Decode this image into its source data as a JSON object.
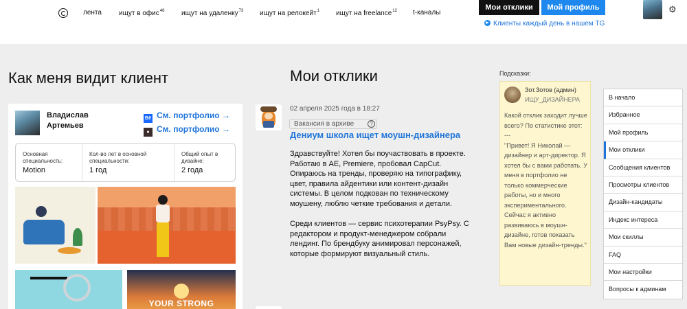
{
  "header": {
    "nav": [
      {
        "label": "лента",
        "count": ""
      },
      {
        "label": "ищут в офис",
        "count": "46"
      },
      {
        "label": "ищут на удаленку",
        "count": "73"
      },
      {
        "label": "ищут на релокейт",
        "count": "1"
      },
      {
        "label": "ищут на freelance",
        "count": "12"
      },
      {
        "label": "t-каналы",
        "count": ""
      }
    ],
    "my_responses_button": "Мои отклики",
    "my_profile_button": "Мой профиль",
    "tg_link": "Клиенты каждый день в нашем TG"
  },
  "left": {
    "title": "Как меня видит клиент",
    "name": "Владислав Артемьев",
    "portfolio_behance": "См. портфолио →",
    "portfolio_dribbble": "См. портфолио →",
    "stats": [
      {
        "label": "Основная специальность:",
        "value": "Motion"
      },
      {
        "label": "Кол-во лет в основной специальности:",
        "value": "1 год"
      },
      {
        "label": "Общий опыт в дизайне:",
        "value": "2 года"
      }
    ],
    "thumb_text": "YOUR STRONG"
  },
  "middle": {
    "title": "Мои отклики",
    "date": "02 апреля 2025 года в 18:27",
    "archive_label": "Вакансия в архиве",
    "vacancy_title": "Дениум школа ищет моушн-дизайнера",
    "paragraphs": [
      "Здравствуйте! Хотел бы поучаствовать в проекте. Работаю в AE, Premiere, пробовал CapCut. Опираюсь на тренды, проверяю на типографику, цвет, правила айдентики или контент-дизайн системы. В целом подкован по техническому моушену, люблю четкие требования и детали.",
      "Среди клиентов — сервис психотерапии PsyPsy. С редактором и продукт-менеджером собрали лендинг. По брендбуку анимировал персонажей, которые формируют визуальный стиль."
    ]
  },
  "hints": {
    "label": "Подсказки:",
    "author": "Зот.Зотов (админ)",
    "role": "ИЩУ_ДИЗАЙНЕРА",
    "body": "Какой отклик заходит лучше всего? По статистике этот:\n---\n\"Привет! Я Николай — дизайнер и арт-директор. Я хотел бы с вами работать. У меня в портфолио не только коммерческие работы, но и много экспериментального. Сейчас я активно развиваюсь в моушн-дизайне, готов показать Вам новые дизайн-тренды.\""
  },
  "menu": {
    "items": [
      "В начало",
      "Избранное",
      "Мой профиль",
      "Мои отклики",
      "Сообщения клиентов",
      "Просмотры клиентов",
      "Дизайн-кандидаты",
      "Индекс интереса",
      "Мои скиллы",
      "FAQ",
      "Мои настройки",
      "Вопросы к админам"
    ],
    "active_index": 3
  },
  "colors": {
    "accent": "#1e74d8",
    "button_blue": "#1e88ee",
    "button_dark": "#111111",
    "hint_bg": "#fdf6cf"
  }
}
